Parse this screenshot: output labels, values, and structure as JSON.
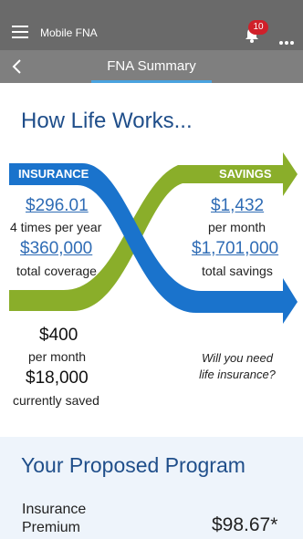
{
  "appbar": {
    "title": "Mobile FNA",
    "notifications_count": "10"
  },
  "subbar": {
    "title": "FNA Summary"
  },
  "hero": {
    "title": "How Life Works...",
    "insurance": {
      "label": "INSURANCE",
      "premium": "$296.01",
      "premium_caption": "4 times per year",
      "coverage": "$360,000",
      "coverage_caption": "total coverage"
    },
    "savings": {
      "label": "SAVINGS",
      "monthly": "$1,432",
      "monthly_caption": "per month",
      "total": "$1,701,000",
      "total_caption": "total savings"
    },
    "current": {
      "monthly": "$400",
      "monthly_caption": "per month",
      "saved": "$18,000",
      "saved_caption": "currently saved"
    },
    "question": [
      "Will you need",
      "life insurance?"
    ],
    "colors": {
      "insurance": "#1a73cc",
      "savings": "#8aae2a",
      "title": "#1f4e8a"
    }
  },
  "program": {
    "title": "Your Proposed Program",
    "premium_label": [
      "Insurance",
      "Premium"
    ],
    "premium_value": "$98.67*"
  }
}
